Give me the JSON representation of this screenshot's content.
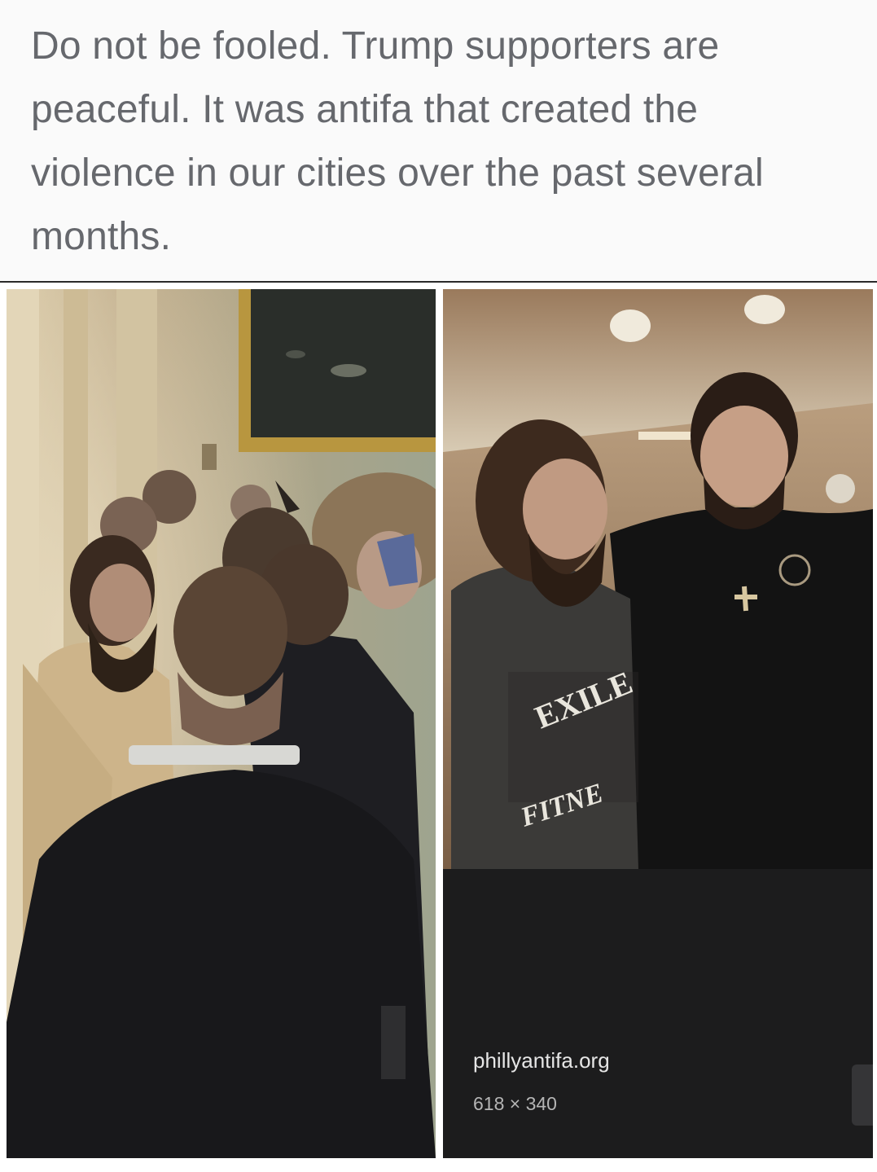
{
  "post": {
    "text": "Do not be fooled. Trump supporters are peaceful. It was antifa that created the violence in our cities over the past several months."
  },
  "images": {
    "left": {
      "content": "photo-capitol-crowd"
    },
    "right": {
      "content": "photo-two-men-indoors",
      "shirt_text_top": "EXILE",
      "shirt_text_bottom": "FITNE"
    }
  },
  "result_card": {
    "domain": "phillyantifa.org",
    "dimensions": "618 × 340"
  },
  "colors": {
    "page_bg": "#fafafa",
    "text": "#66686d",
    "card_bg": "#1c1c1d"
  }
}
